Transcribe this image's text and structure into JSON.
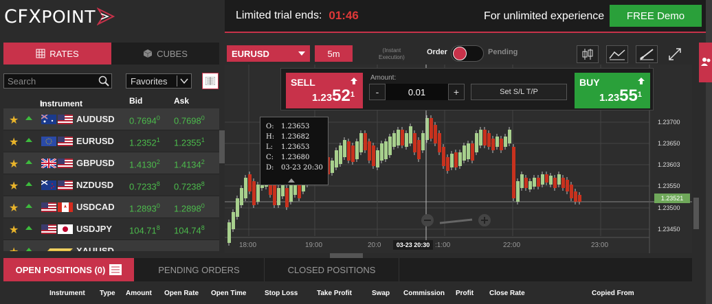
{
  "brand": {
    "logo": "CFXPOINT",
    "logo_head": "CFX",
    "logo_tail": "POINT",
    "accent": "#c8324a",
    "green": "#2aa03a"
  },
  "trial": {
    "label": "Limited trial ends:",
    "time": "01:46",
    "unlimited": "For unlimited experience",
    "demo_button": "FREE Demo"
  },
  "left_tabs": {
    "rates": "RATES",
    "cubes": "CUBES"
  },
  "search": {
    "placeholder": "Search"
  },
  "favorites": {
    "selected": "Favorites"
  },
  "columns": {
    "instrument": "Instrument",
    "bid": "Bid",
    "ask": "Ask"
  },
  "rates": [
    {
      "symbol": "AUDUSD",
      "bid": "0.7694",
      "bid_sup": "0",
      "ask": "0.7698",
      "ask_sup": "0",
      "flag1": "au",
      "flag2": "us"
    },
    {
      "symbol": "EURUSD",
      "bid": "1.2352",
      "bid_sup": "1",
      "ask": "1.2355",
      "ask_sup": "1",
      "flag1": "eu",
      "flag2": "us"
    },
    {
      "symbol": "GBPUSD",
      "bid": "1.4130",
      "bid_sup": "2",
      "ask": "1.4134",
      "ask_sup": "2",
      "flag1": "gb",
      "flag2": "us"
    },
    {
      "symbol": "NZDUSD",
      "bid": "0.7233",
      "bid_sup": "8",
      "ask": "0.7238",
      "ask_sup": "8",
      "flag1": "nz",
      "flag2": "us"
    },
    {
      "symbol": "USDCAD",
      "bid": "1.2893",
      "bid_sup": "0",
      "ask": "1.2898",
      "ask_sup": "0",
      "flag1": "us",
      "flag2": "ca"
    },
    {
      "symbol": "USDJPY",
      "bid": "104.71",
      "bid_sup": "8",
      "ask": "104.74",
      "ask_sup": "8",
      "flag1": "us",
      "flag2": "jp"
    },
    {
      "symbol": "XAUUSD",
      "bid": "",
      "bid_sup": "",
      "ask": "",
      "ask_sup": "",
      "flag1": "gold",
      "flag2": ""
    }
  ],
  "toolbar": {
    "symbol": "EURUSD",
    "timeframe": "5m",
    "instant_line1": "(Instant",
    "instant_line2": "Execution)",
    "order": "Order",
    "pending": "Pending"
  },
  "trade": {
    "sell_label": "SELL",
    "sell_pre": "1.23",
    "sell_big": "52",
    "sell_sup": "1",
    "buy_label": "BUY",
    "buy_pre": "1.23",
    "buy_big": "55",
    "buy_sup": "1",
    "amount_label": "Amount:",
    "amount": "0.01",
    "minus": "-",
    "plus": "+",
    "sltp": "Set S/L T/P"
  },
  "tooltip": {
    "o_k": "O:",
    "o": "1.23653",
    "h_k": "H:",
    "h": "1.23682",
    "l_k": "L:",
    "l": "1.23653",
    "c_k": "C:",
    "c": "1.23680",
    "d_k": "D:",
    "d": "03-23 20:30"
  },
  "chart": {
    "current_price": "1.23521",
    "cursor_time": "03-23 20:30",
    "y_ticks": [
      "1.23700",
      "1.23650",
      "1.23603",
      "1.23550",
      "1.23500",
      "1.23450"
    ],
    "x_ticks": [
      "18:00",
      "19:00",
      "20:0",
      ":1:00",
      "22:00",
      "23:00"
    ]
  },
  "bottom_tabs": {
    "open": "OPEN POSITIONS (0)",
    "pending": "PENDING ORDERS",
    "closed": "CLOSED POSITIONS"
  },
  "position_columns": [
    "Instrument",
    "Type",
    "Amount",
    "Open Rate",
    "Open Time",
    "Stop Loss",
    "Take Profit",
    "Swap",
    "Commission",
    "Profit",
    "Close Rate",
    "Copied From"
  ]
}
